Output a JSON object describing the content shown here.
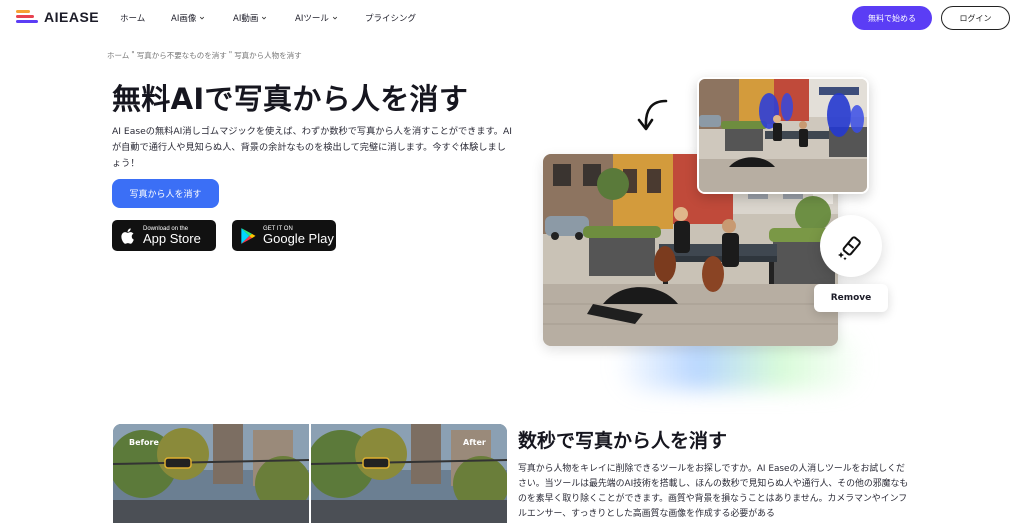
{
  "header": {
    "logo_text": "AIEASE",
    "nav": [
      {
        "label": "ホーム",
        "has_dropdown": false
      },
      {
        "label": "AI画像",
        "has_dropdown": true
      },
      {
        "label": "AI動画",
        "has_dropdown": true
      },
      {
        "label": "AIツール",
        "has_dropdown": true
      },
      {
        "label": "プライシング",
        "has_dropdown": false
      }
    ],
    "cta_label": "無料で始める",
    "login_label": "ログイン"
  },
  "breadcrumb": [
    "ホーム",
    "写真から不要なものを消す",
    "写真から人物を消す"
  ],
  "hero": {
    "title": "無料AIで写真から人を消す",
    "description": "AI Easeの無料AI消しゴムマジックを使えば、わずか数秒で写真から人を消すことができます。AIが自動で通行人や見知らぬ人、背景の余計なものを検出して完璧に消します。今すぐ体験しましょう！",
    "primary_button": "写真から人を消す",
    "app_store": {
      "small": "Download on the",
      "big": "App Store"
    },
    "google_play": {
      "small": "GET IT ON",
      "big": "Google Play"
    },
    "remove_button": "Remove"
  },
  "section2": {
    "before_label": "Before",
    "after_label": "After",
    "title": "数秒で写真から人を消す",
    "description": "写真から人物をキレイに削除できるツールをお探しですか。AI Easeの人消しツールをお試しください。当ツールは最先端のAI技術を搭載し、ほんの数秒で見知らぬ人や通行人、その他の邪魔なものを素早く取り除くことができます。画質や背景を損なうことはありません。カメラマンやインフルエンサー、すっきりとした高画質な画像を作成する必要がある"
  },
  "colors": {
    "accent": "#5b3df5",
    "primary": "#3b6ff6",
    "text": "#1c1c28"
  }
}
